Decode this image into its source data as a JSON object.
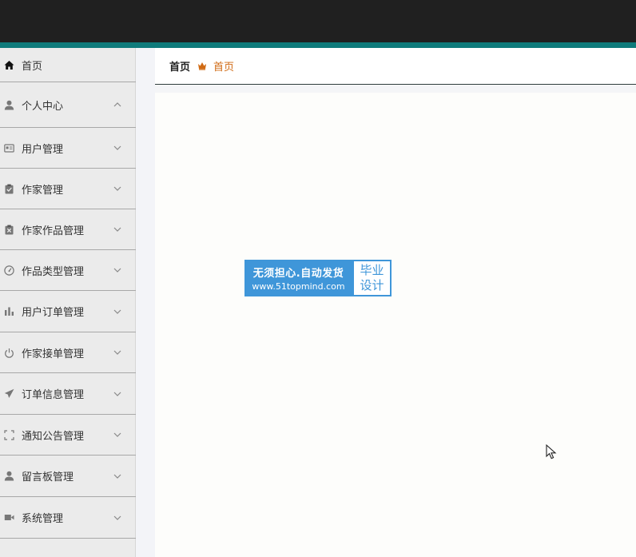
{
  "breadcrumb": {
    "first": "首页",
    "current": "首页"
  },
  "sidebar": {
    "items": [
      {
        "label": "首页",
        "icon": "home-icon"
      },
      {
        "label": "个人中心",
        "icon": "user-icon",
        "expanded": true
      },
      {
        "label": "用户管理",
        "icon": "id-card-icon"
      },
      {
        "label": "作家管理",
        "icon": "clipboard-check-icon"
      },
      {
        "label": "作家作品管理",
        "icon": "clipboard-x-icon"
      },
      {
        "label": "作品类型管理",
        "icon": "gauge-icon"
      },
      {
        "label": "用户订单管理",
        "icon": "bar-chart-icon"
      },
      {
        "label": "作家接单管理",
        "icon": "power-icon"
      },
      {
        "label": "订单信息管理",
        "icon": "send-icon"
      },
      {
        "label": "通知公告管理",
        "icon": "expand-icon"
      },
      {
        "label": "留言板管理",
        "icon": "user-icon"
      },
      {
        "label": "系统管理",
        "icon": "video-icon"
      }
    ]
  },
  "watermark": {
    "line1": "无须担心.自动发货",
    "line2": "www.51topmind.com",
    "right1": "毕业",
    "right2": "设计"
  },
  "colors": {
    "topbar": "#202020",
    "accent": "#0f7b7b",
    "sidebar_bg": "#ebebeb",
    "breadcrumb_current": "#d06a14",
    "watermark_blue": "#3f96d9"
  }
}
